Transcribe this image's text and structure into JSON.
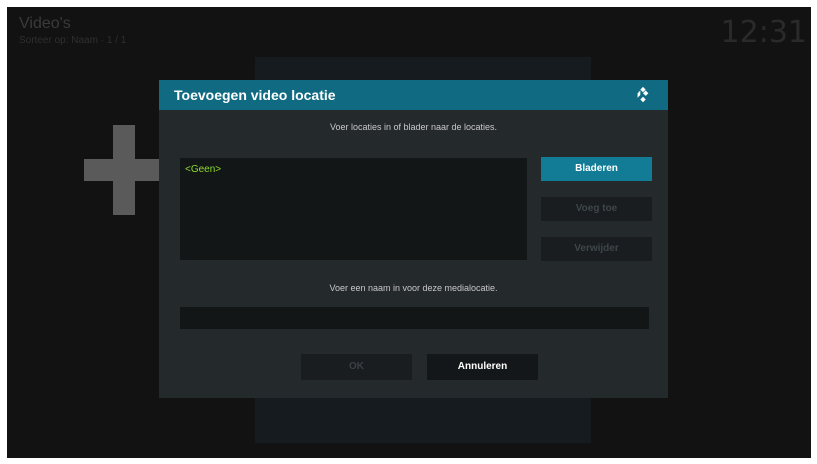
{
  "screen": {
    "title": "Video's",
    "subtitle": "Sorteer op: Naam · 1 / 1",
    "clock": "12:31"
  },
  "dialog": {
    "title": "Toevoegen video locatie",
    "icon": "kodi-logo-icon",
    "instruction_top": "Voer locaties in of blader naar de locaties.",
    "locations": [
      "<Geen>"
    ],
    "buttons": {
      "browse": "Bladeren",
      "add": "Voeg toe",
      "remove": "Verwijder",
      "ok": "OK",
      "cancel": "Annuleren"
    },
    "instruction_name": "Voer een naam in voor deze medialocatie.",
    "name_value": ""
  },
  "colors": {
    "header": "#106b82",
    "focused_button": "#127c96",
    "list_text": "#8ddc2f",
    "dialog_bg": "#24292c"
  }
}
